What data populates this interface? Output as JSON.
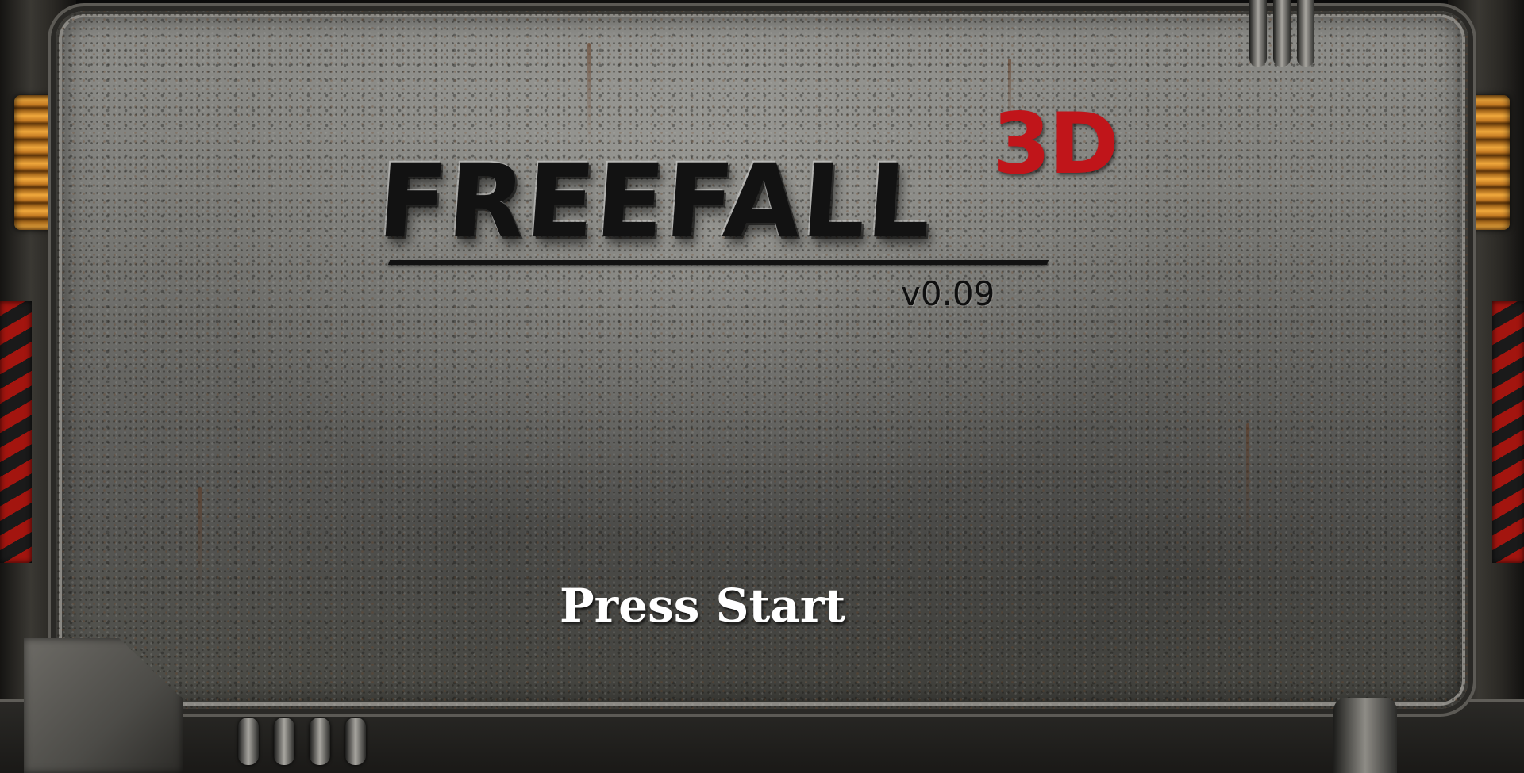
{
  "game": {
    "logo_word": "FREEFALL",
    "logo_suffix": "3D",
    "version": "v0.09",
    "prompt": "Press Start"
  },
  "colors": {
    "logo_accent": "#c0151a",
    "logo_ink": "#121212",
    "prompt_text": "#ffffff",
    "coil": "#f0a83c",
    "hazard_stripe": "#a3150f"
  },
  "decor": {
    "background": "riveted-metal-plate",
    "left_side": [
      "orange-coil",
      "hazard-stripes"
    ],
    "right_side": [
      "orange-coil",
      "hazard-stripes"
    ]
  }
}
